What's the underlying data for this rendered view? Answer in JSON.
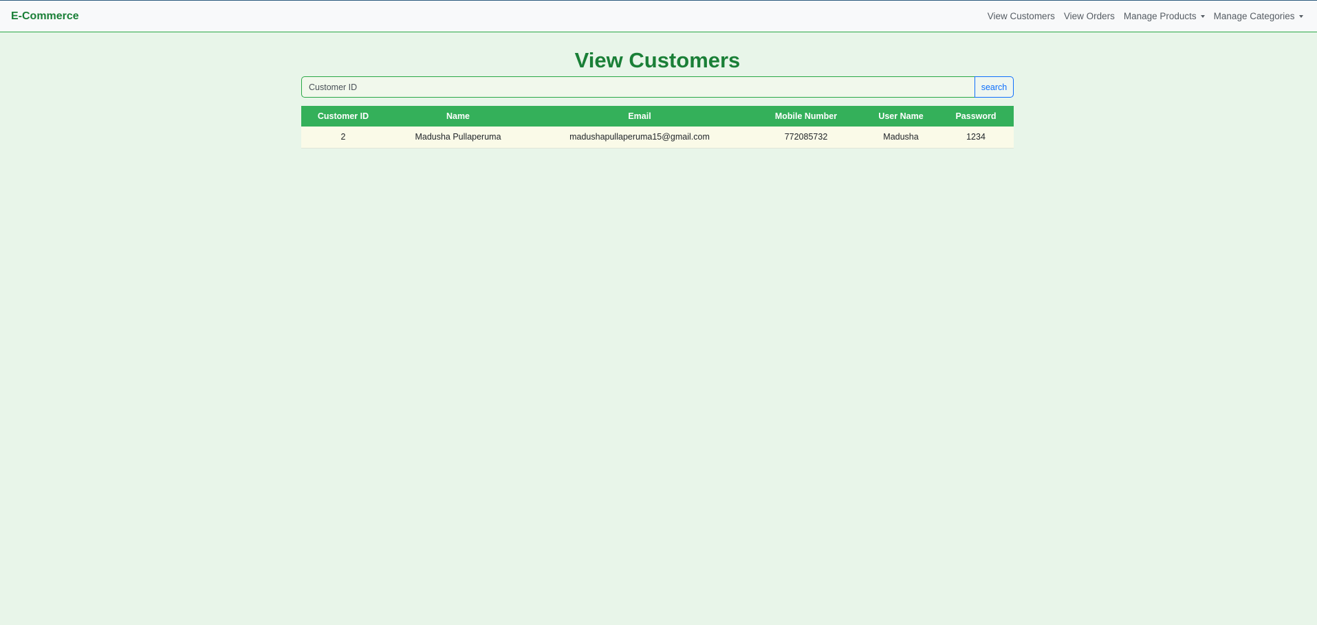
{
  "navbar": {
    "brand": "E-Commerce",
    "links": [
      {
        "label": "View Customers"
      },
      {
        "label": "View Orders"
      },
      {
        "label": "Manage Products"
      },
      {
        "label": "Manage Categories"
      }
    ]
  },
  "page": {
    "title": "View Customers"
  },
  "search": {
    "placeholder": "Customer ID",
    "button_label": "search"
  },
  "table": {
    "headers": [
      "Customer ID",
      "Name",
      "Email",
      "Mobile Number",
      "User Name",
      "Password"
    ],
    "rows": [
      [
        "2",
        "Madusha Pullaperuma",
        "madushapullaperuma15@gmail.com",
        "772085732",
        "Madusha",
        "1234"
      ]
    ]
  },
  "colors": {
    "accent": "#1a7f37",
    "table_header": "#34b05a",
    "background": "#e8f5e9",
    "button": "#0d6efd"
  }
}
